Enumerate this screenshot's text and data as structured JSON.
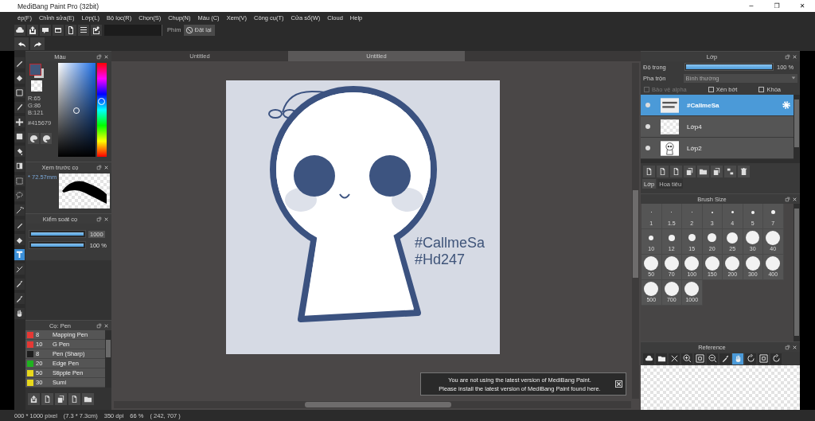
{
  "window": {
    "title": "MediBang Paint Pro (32bit)",
    "controls": [
      "─",
      "❐",
      "✕"
    ]
  },
  "menu": [
    "ép(F)",
    "Chỉnh sửa(E)",
    "Lớp(L)",
    "Bộ lọc(R)",
    "Chọn(S)",
    "Chụp(N)",
    "Màu (C)",
    "Xem(V)",
    "Công cụ(T)",
    "Cửa sổ(W)",
    "Cloud",
    "Help"
  ],
  "shortcut_bar": {
    "label": "Phím",
    "reset_button": "Đặt lại"
  },
  "tools": [
    {
      "kind": "pen",
      "selected": false
    },
    {
      "kind": "eraser",
      "selected": false
    },
    {
      "kind": "square",
      "selected": false
    },
    {
      "kind": "brush",
      "selected": false
    },
    {
      "kind": "move",
      "selected": false
    },
    {
      "kind": "fill",
      "selected": false
    },
    {
      "kind": "bucket",
      "selected": false
    },
    {
      "kind": "gradient",
      "selected": false
    },
    {
      "kind": "selection",
      "selected": false
    },
    {
      "kind": "lasso",
      "selected": false
    },
    {
      "kind": "wand",
      "selected": false
    },
    {
      "kind": "pencil",
      "selected": false
    },
    {
      "kind": "eraser",
      "selected": false
    },
    {
      "kind": "text",
      "selected": true
    },
    {
      "kind": "cut",
      "selected": false
    },
    {
      "kind": "dropper",
      "selected": false
    },
    {
      "kind": "dropper",
      "selected": false
    },
    {
      "kind": "hand",
      "selected": false
    }
  ],
  "color_panel": {
    "title": "Màu",
    "r": "R:65",
    "g": "G:86",
    "b": "B:121",
    "hex": "#415679"
  },
  "brush_preview": {
    "title": "Xem trước cọ",
    "size": "* 72.57mm"
  },
  "brush_control": {
    "title": "Kiểm soát cọ",
    "sliders": [
      {
        "level": 1,
        "reading": "1000",
        "boxed": true
      },
      {
        "level": 1,
        "reading": "100 %",
        "boxed": false
      }
    ]
  },
  "brush_list": {
    "title": "Cọ: Pen",
    "items": [
      {
        "color": "#e53935",
        "size": "8",
        "name": "Mapping Pen"
      },
      {
        "color": "#e53935",
        "size": "10",
        "name": "G Pen"
      },
      {
        "color": "#1e1e1e",
        "size": "8",
        "name": "Pen (Sharp)"
      },
      {
        "color": "#1fb21f",
        "size": "20",
        "name": "Edge Pen"
      },
      {
        "color": "#e8d81c",
        "size": "50",
        "name": "Stipple Pen"
      },
      {
        "color": "#e8d81c",
        "size": "30",
        "name": "Sumi"
      }
    ]
  },
  "document_tabs": [
    {
      "label": "Untitled",
      "selected": false
    },
    {
      "label": "Untitled",
      "selected": true
    }
  ],
  "canvas": {
    "texts": [
      "#CallmeSa",
      "#Hd247"
    ]
  },
  "notification": {
    "lines": [
      "You are not using the latest version of MediBang Paint.",
      "Please install the latest version of MediBang Paint found here."
    ]
  },
  "layer_panel": {
    "title": "Lớp",
    "opacity": {
      "label": "Độ trong",
      "level": 1,
      "reading": "100 %"
    },
    "blend": {
      "label": "Pha trộn",
      "value": "Bình thường"
    },
    "options": [
      {
        "label": "Bảo vệ alpha",
        "checked": false,
        "disabled": true
      },
      {
        "label": "Xén bớt",
        "checked": false,
        "disabled": false
      },
      {
        "label": "Khóa",
        "checked": false,
        "disabled": false
      }
    ],
    "layers": [
      {
        "name": "#CallmeSa",
        "kind": "text",
        "selected": true
      },
      {
        "name": "Lớp4",
        "kind": "empty",
        "selected": false
      },
      {
        "name": "Lớp2",
        "kind": "sketch",
        "selected": false
      }
    ],
    "tabs": [
      {
        "label": "Lớp",
        "selected": true
      },
      {
        "label": "Hoa tiêu",
        "selected": false
      }
    ]
  },
  "brush_size_panel": {
    "title": "Brush Size",
    "sizes": [
      "1",
      "1.5",
      "2",
      "3",
      "4",
      "5",
      "7",
      "10",
      "12",
      "15",
      "20",
      "25",
      "30",
      "40",
      "50",
      "70",
      "100",
      "150",
      "200",
      "300",
      "400",
      "500",
      "700",
      "1000"
    ]
  },
  "reference_panel": {
    "title": "Reference",
    "tools": [
      {
        "kind": "cloud",
        "selected": false
      },
      {
        "kind": "folder",
        "selected": false
      },
      {
        "kind": "close",
        "selected": false
      },
      {
        "kind": "zoomin",
        "selected": false
      },
      {
        "kind": "fit",
        "selected": false
      },
      {
        "kind": "zoomout",
        "selected": false
      },
      {
        "kind": "dropper",
        "selected": false
      },
      {
        "kind": "hand",
        "selected": true
      },
      {
        "kind": "rotate",
        "selected": false
      },
      {
        "kind": "fit",
        "selected": false
      },
      {
        "kind": "rotate",
        "selected": false
      }
    ]
  },
  "status_bar": [
    "000 * 1000 pixel",
    "(7.3 * 7.3cm)",
    "350 dpi",
    "66 %",
    "( 242, 707 )"
  ]
}
